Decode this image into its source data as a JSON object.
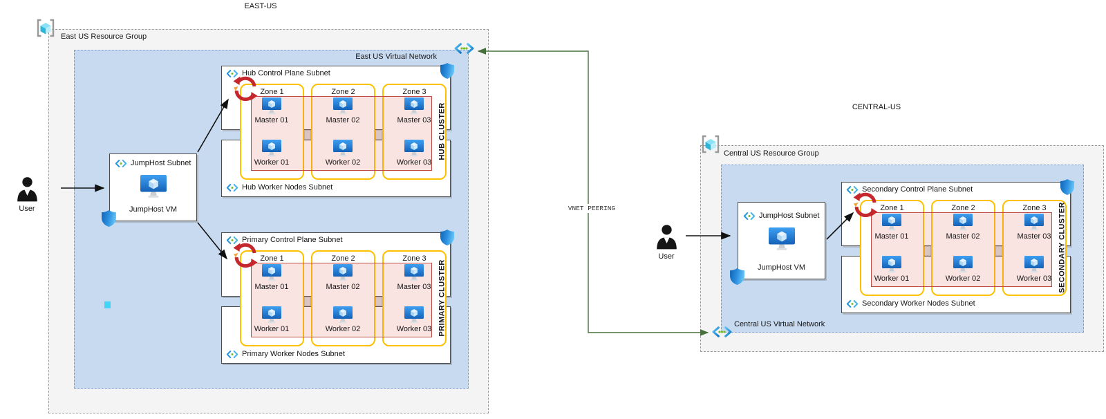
{
  "east": {
    "region_title": "EAST-US",
    "resource_group_label": "East US Resource Group",
    "vnet_label": "East US Virtual Network",
    "user_label": "User",
    "jumphost_subnet_label": "JumpHost Subnet",
    "jumphost_vm_label": "JumpHost VM"
  },
  "central": {
    "region_title": "CENTRAL-US",
    "resource_group_label": "Central US Resource Group",
    "vnet_label": "Central US Virtual Network",
    "user_label": "User",
    "jumphost_subnet_label": "JumpHost Subnet",
    "jumphost_vm_label": "JumpHost VM"
  },
  "peering": {
    "label": "VNET PEERING"
  },
  "clusters": [
    {
      "id": "hub",
      "control_plane_subnet_label": "Hub Control Plane Subnet",
      "worker_nodes_subnet_label": "Hub Worker Nodes Subnet",
      "cluster_label": "HUB CLUSTER",
      "zones": [
        {
          "label": "Zone 1",
          "master": "Master 01",
          "worker": "Worker 01"
        },
        {
          "label": "Zone 2",
          "master": "Master 02",
          "worker": "Worker 02"
        },
        {
          "label": "Zone 3",
          "master": "Master 03",
          "worker": "Worker 03"
        }
      ]
    },
    {
      "id": "primary",
      "control_plane_subnet_label": "Primary Control Plane Subnet",
      "worker_nodes_subnet_label": "Primary Worker Nodes Subnet",
      "cluster_label": "PRIMARY CLUSTER",
      "zones": [
        {
          "label": "Zone 1",
          "master": "Master 01",
          "worker": "Worker 01"
        },
        {
          "label": "Zone 2",
          "master": "Master 02",
          "worker": "Worker 02"
        },
        {
          "label": "Zone 3",
          "master": "Master 03",
          "worker": "Worker 03"
        }
      ]
    },
    {
      "id": "secondary",
      "control_plane_subnet_label": "Secondary Control Plane Subnet",
      "worker_nodes_subnet_label": "Secondary Worker Nodes Subnet",
      "cluster_label": "SECONDARY CLUSTER",
      "zones": [
        {
          "label": "Zone 1",
          "master": "Master 01",
          "worker": "Worker 01"
        },
        {
          "label": "Zone 2",
          "master": "Master 02",
          "worker": "Worker 02"
        },
        {
          "label": "Zone 3",
          "master": "Master 03",
          "worker": "Worker 03"
        }
      ]
    }
  ],
  "colors": {
    "vnet_fill": "#c8daf0",
    "vnet_border": "#7b9cd0",
    "rg_fill": "#f4f4f5",
    "rg_border": "#9b9b9b",
    "zone_border": "#ffc000",
    "overlay_border": "#bf4a45",
    "peering_line": "#48703c",
    "arrow_black": "#111111",
    "sync_red": "#c4272c",
    "azure_blue": "#2596dc",
    "dot_green": "#76bc2d"
  }
}
